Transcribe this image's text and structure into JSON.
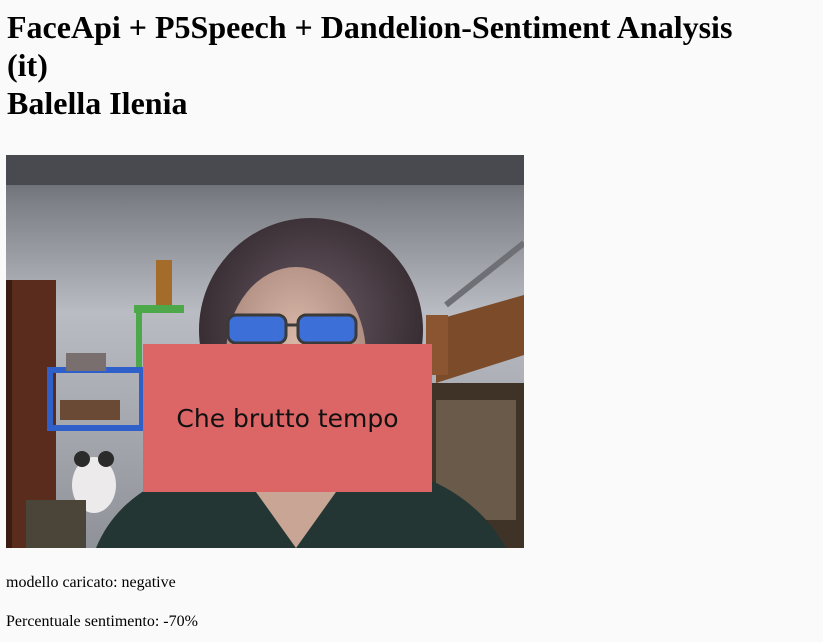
{
  "header": {
    "title_line1": "FaceApi + P5Speech + Dandelion-Sentiment Analysis",
    "title_line2": "(it)",
    "author": "Balella Ilenia"
  },
  "canvas": {
    "speech_text": "Che brutto tempo",
    "box_color": "#dc6566"
  },
  "status": {
    "model_label": "modello caricato:",
    "model_value": "negative",
    "sentiment_label": "Percentuale sentimento:",
    "sentiment_value": "-70%"
  }
}
